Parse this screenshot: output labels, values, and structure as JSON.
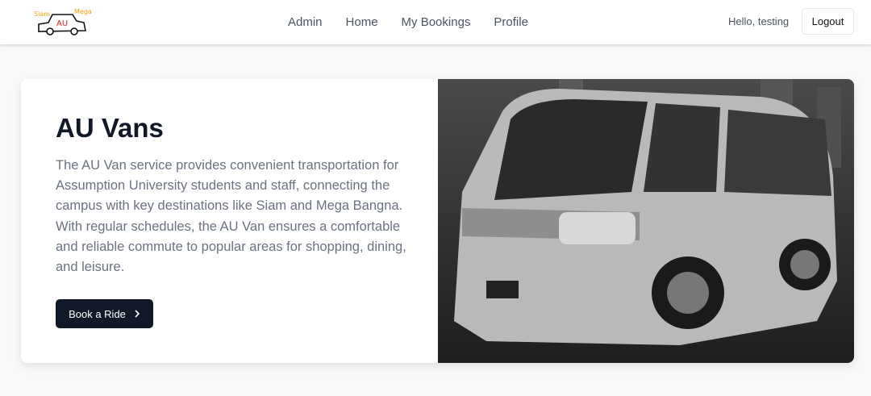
{
  "nav": {
    "logo_text": {
      "left": "Siam",
      "center": "AU",
      "right": "Mega"
    },
    "links": [
      {
        "label": "Admin"
      },
      {
        "label": "Home"
      },
      {
        "label": "My Bookings"
      },
      {
        "label": "Profile"
      }
    ],
    "greeting": "Hello, testing",
    "logout_label": "Logout"
  },
  "hero": {
    "title": "AU Vans",
    "description": "The AU Van service provides convenient transportation for Assumption University students and staff, connecting the campus with key destinations like Siam and Mega Bangna. With regular schedules, the AU Van ensures a comfortable and reliable commute to popular areas for shopping, dining, and leisure.",
    "button_label": "Book a Ride",
    "button_icon": "chevron-right-icon"
  }
}
